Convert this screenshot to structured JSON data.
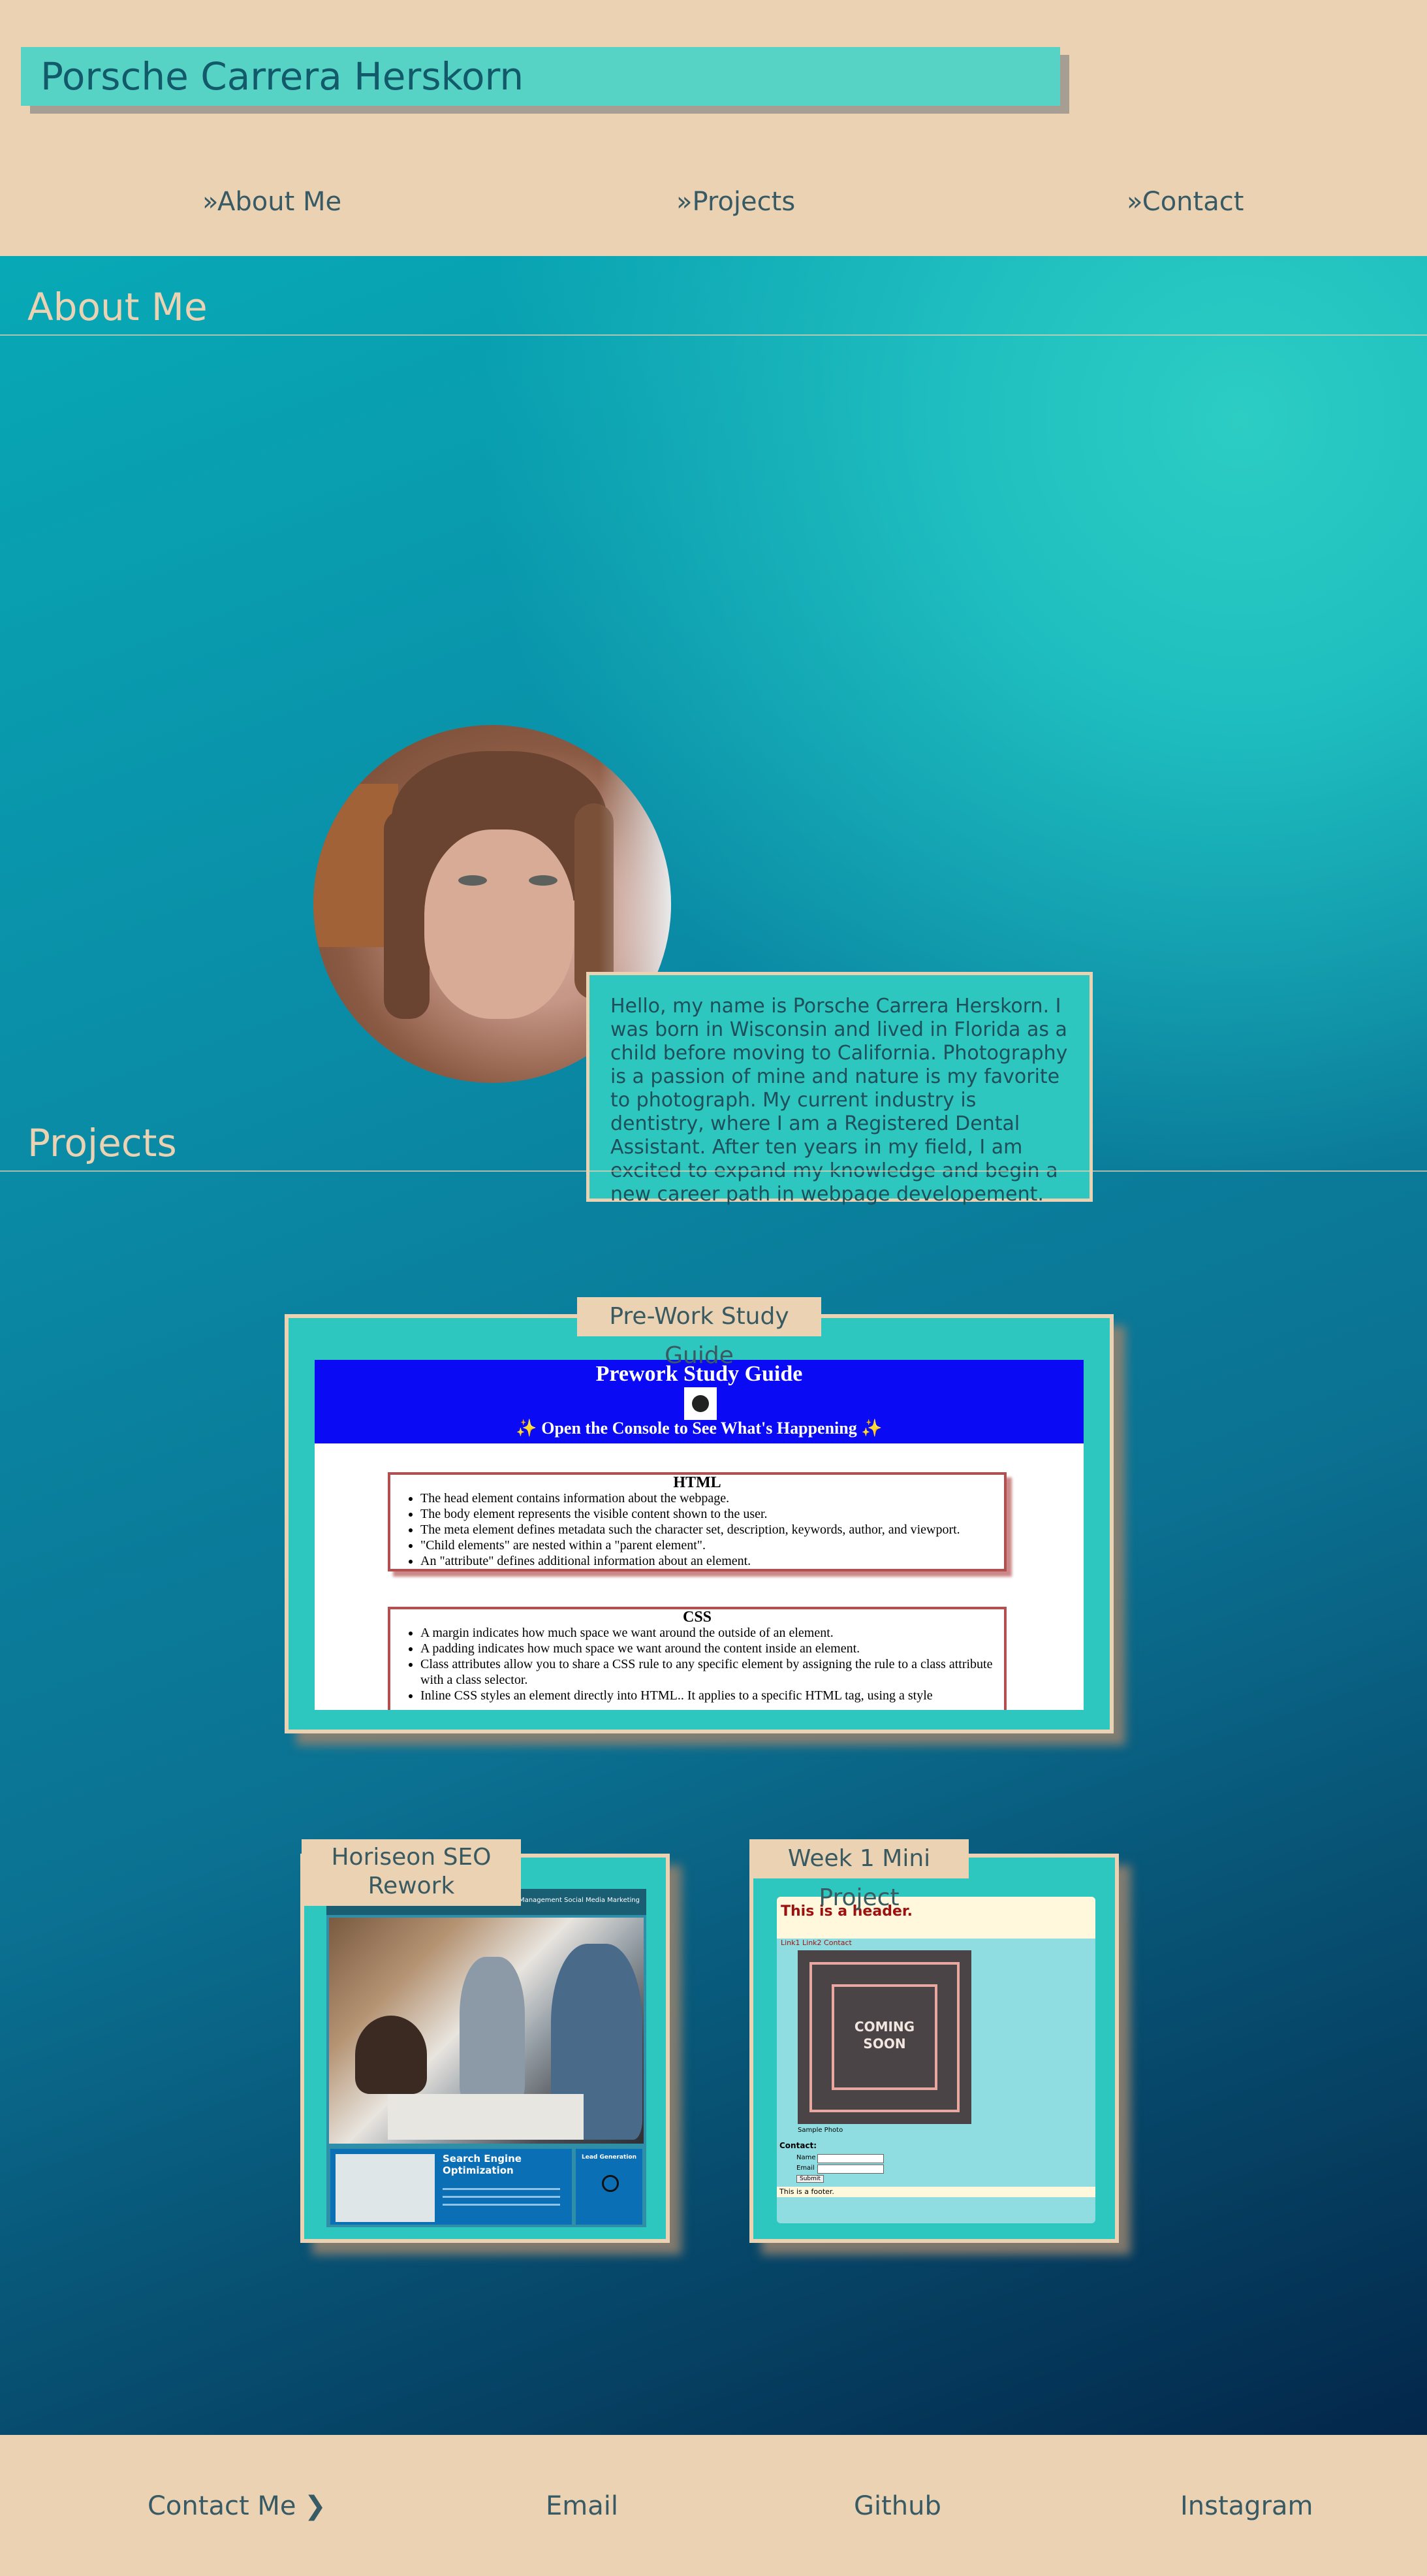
{
  "header": {
    "title": "Porsche Carrera Herskorn",
    "nav": [
      {
        "label": "»About Me"
      },
      {
        "label": "»Projects"
      },
      {
        "label": "»Contact"
      }
    ]
  },
  "about": {
    "heading": "About Me",
    "bio": "Hello, my name is Porsche Carrera Herskorn. I was born in Wisconsin and lived in Florida as a child before moving to California. Photography is a passion of mine and nature is my favorite to photograph. My current industry is dentistry, where I am a Registered Dental Assistant. After ten years in my field, I am excited to expand my knowledge and begin a new career path in webpage developement."
  },
  "projects": {
    "heading": "Projects",
    "prework": {
      "label": "Pre-Work Study Guide",
      "shot_title": "Prework Study Guide",
      "shot_subtitle": "✨ Open the Console to See What's Happening ✨",
      "html_heading": "HTML",
      "html_items": [
        "The head element contains information about the webpage.",
        "The body element represents the visible content shown to the user.",
        "The meta element defines metadata such the character set, description, keywords, author, and viewport.",
        "\"Child elements\" are nested within a \"parent element\".",
        "An \"attribute\" defines additional information about an element."
      ],
      "css_heading": "CSS",
      "css_items": [
        "A margin indicates how much space we want around the outside of an element.",
        "A padding indicates how much space we want around the content inside an element.",
        "Class attributes allow you to share a CSS rule to any specific element by assigning the rule to a class attribute with a class selector.",
        "Inline CSS styles an element directly into HTML.. It applies to a specific HTML tag, using a style"
      ]
    },
    "horiseon": {
      "label": "Horiseon SEO Rework",
      "nav_text": "Online Reputation Management    Social Media Marketing",
      "seo_title": "Search Engine Optimization",
      "lead_title": "Lead Generation"
    },
    "week1": {
      "label": "Week 1 Mini Project",
      "header_text": "This is a header.",
      "links_text": "Link1 Link2 Contact",
      "coming_soon": "COMING SOON",
      "sample_photo": "Sample Photo",
      "contact_label": "Contact:",
      "name_label": "Name",
      "email_label": "Email",
      "submit_label": "Submit",
      "footer_text": "This is a footer."
    }
  },
  "footer": {
    "contact_label": "Contact Me ❯",
    "links": [
      {
        "label": "Email"
      },
      {
        "label": "Github"
      },
      {
        "label": "Instagram"
      }
    ]
  },
  "colors": {
    "sand": "#ebd2b2",
    "teal": "#2ec7c0",
    "title_bg": "#57d3c6",
    "deep": "#03274a"
  }
}
